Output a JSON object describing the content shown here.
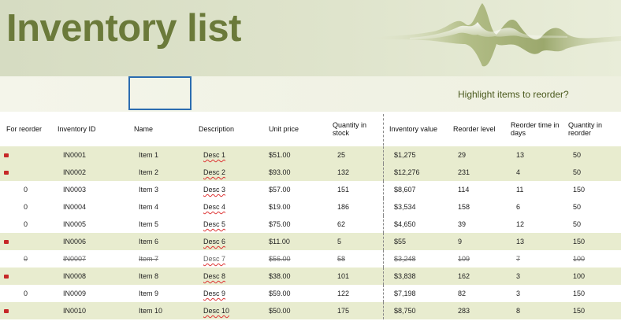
{
  "title": "Inventory list",
  "highlight_label": "Highlight items to reorder?",
  "columns": [
    "For reorder",
    "Inventory ID",
    "Name",
    "Description",
    "Unit price",
    "Quantity in stock",
    "Inventory value",
    "Reorder level",
    "Reorder time in days",
    "Quantity in reorder"
  ],
  "rows": [
    {
      "flag": "",
      "id": "IN0001",
      "name": "Item 1",
      "desc": "Desc 1",
      "price": "$51.00",
      "qty": "25",
      "value": "$1,275",
      "reorder": "29",
      "days": "13",
      "reorder_qty": "50",
      "flagged": true,
      "shade": true,
      "strike": false
    },
    {
      "flag": "",
      "id": "IN0002",
      "name": "Item 2",
      "desc": "Desc 2",
      "price": "$93.00",
      "qty": "132",
      "value": "$12,276",
      "reorder": "231",
      "days": "4",
      "reorder_qty": "50",
      "flagged": true,
      "shade": true,
      "strike": false
    },
    {
      "flag": "0",
      "id": "IN0003",
      "name": "Item 3",
      "desc": "Desc 3",
      "price": "$57.00",
      "qty": "151",
      "value": "$8,607",
      "reorder": "114",
      "days": "11",
      "reorder_qty": "150",
      "flagged": false,
      "shade": false,
      "strike": false
    },
    {
      "flag": "0",
      "id": "IN0004",
      "name": "Item 4",
      "desc": "Desc 4",
      "price": "$19.00",
      "qty": "186",
      "value": "$3,534",
      "reorder": "158",
      "days": "6",
      "reorder_qty": "50",
      "flagged": false,
      "shade": false,
      "strike": false
    },
    {
      "flag": "0",
      "id": "IN0005",
      "name": "Item 5",
      "desc": "Desc 5",
      "price": "$75.00",
      "qty": "62",
      "value": "$4,650",
      "reorder": "39",
      "days": "12",
      "reorder_qty": "50",
      "flagged": false,
      "shade": false,
      "strike": false
    },
    {
      "flag": "",
      "id": "IN0006",
      "name": "Item 6",
      "desc": "Desc 6",
      "price": "$11.00",
      "qty": "5",
      "value": "$55",
      "reorder": "9",
      "days": "13",
      "reorder_qty": "150",
      "flagged": true,
      "shade": true,
      "strike": false
    },
    {
      "flag": "0",
      "id": "IN0007",
      "name": "Item 7",
      "desc": "Desc 7",
      "price": "$56.00",
      "qty": "58",
      "value": "$3,248",
      "reorder": "109",
      "days": "7",
      "reorder_qty": "100",
      "flagged": false,
      "shade": false,
      "strike": true
    },
    {
      "flag": "",
      "id": "IN0008",
      "name": "Item 8",
      "desc": "Desc 8",
      "price": "$38.00",
      "qty": "101",
      "value": "$3,838",
      "reorder": "162",
      "days": "3",
      "reorder_qty": "100",
      "flagged": true,
      "shade": true,
      "strike": false
    },
    {
      "flag": "0",
      "id": "IN0009",
      "name": "Item 9",
      "desc": "Desc 9",
      "price": "$59.00",
      "qty": "122",
      "value": "$7,198",
      "reorder": "82",
      "days": "3",
      "reorder_qty": "150",
      "flagged": false,
      "shade": false,
      "strike": false
    },
    {
      "flag": "",
      "id": "IN0010",
      "name": "Item 10",
      "desc": "Desc 10",
      "price": "$50.00",
      "qty": "175",
      "value": "$8,750",
      "reorder": "283",
      "days": "8",
      "reorder_qty": "150",
      "flagged": true,
      "shade": true,
      "strike": false
    }
  ],
  "colors": {
    "title": "#6b7a3a",
    "row_shade": "#e8eccf",
    "flag": "#c62828",
    "selection": "#2b6cb0"
  }
}
